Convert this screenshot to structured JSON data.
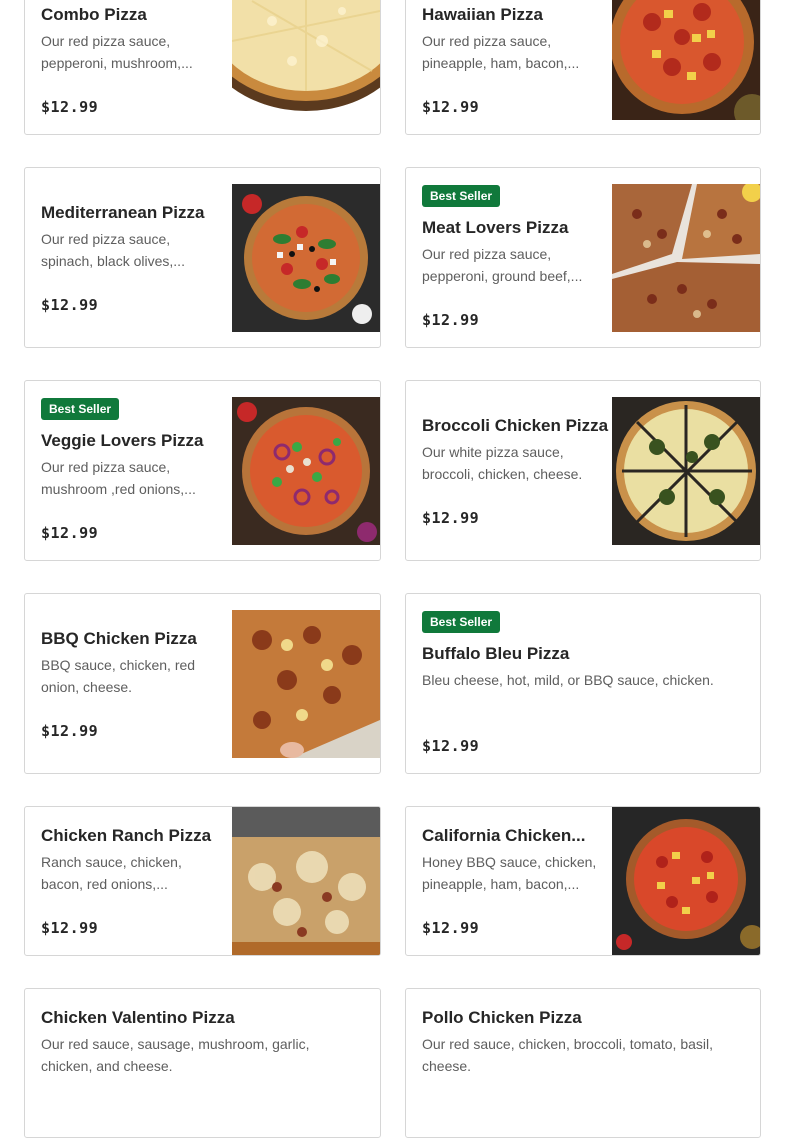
{
  "menu": {
    "items": [
      {
        "name": "Combo Pizza",
        "description_line1": "Our red pizza sauce,",
        "description_line2": "pepperoni, mushroom,...",
        "price": "$12.99",
        "badge": "",
        "image": "combo-pizza-image"
      },
      {
        "name": "Hawaiian Pizza",
        "description_line1": "Our red pizza sauce,",
        "description_line2": "pineapple, ham, bacon,...",
        "price": "$12.99",
        "badge": "",
        "image": "hawaiian-pizza-image"
      },
      {
        "name": "Mediterranean Pizza",
        "description_line1": "Our red pizza sauce,",
        "description_line2": "spinach, black olives,...",
        "price": "$12.99",
        "badge": "",
        "image": "mediterranean-pizza-image"
      },
      {
        "name": "Meat Lovers Pizza",
        "description_line1": "Our red pizza sauce,",
        "description_line2": "pepperoni, ground beef,...",
        "price": "$12.99",
        "badge": "Best Seller",
        "image": "meat-lovers-pizza-image"
      },
      {
        "name": "Veggie Lovers Pizza",
        "description_line1": "Our red pizza sauce,",
        "description_line2": "mushroom ,red onions,...",
        "price": "$12.99",
        "badge": "Best Seller",
        "image": "veggie-lovers-pizza-image"
      },
      {
        "name": "Broccoli Chicken Pizza",
        "description_line1": "Our white pizza sauce,",
        "description_line2": "broccoli, chicken, cheese.",
        "price": "$12.99",
        "badge": "",
        "image": "broccoli-chicken-pizza-image"
      },
      {
        "name": "BBQ Chicken Pizza",
        "description_line1": "BBQ sauce, chicken, red",
        "description_line2": "onion, cheese.",
        "price": "$12.99",
        "badge": "",
        "image": "bbq-chicken-pizza-image"
      },
      {
        "name": "Buffalo Bleu Pizza",
        "description_line1": "Bleu cheese, hot, mild, or BBQ sauce, chicken.",
        "description_line2": "",
        "price": "$12.99",
        "badge": "Best Seller",
        "image": ""
      },
      {
        "name": "Chicken Ranch Pizza",
        "description_line1": "Ranch sauce, chicken,",
        "description_line2": "bacon, red onions,...",
        "price": "$12.99",
        "badge": "",
        "image": "chicken-ranch-pizza-image"
      },
      {
        "name": "California Chicken...",
        "description_line1": "Honey BBQ sauce, chicken,",
        "description_line2": "pineapple, ham, bacon,...",
        "price": "$12.99",
        "badge": "",
        "image": "california-chicken-pizza-image"
      },
      {
        "name": "Chicken Valentino Pizza",
        "description_line1": "Our red sauce, sausage, mushroom, garlic,",
        "description_line2": "chicken, and cheese.",
        "price": "",
        "badge": "",
        "image": ""
      },
      {
        "name": "Pollo Chicken Pizza",
        "description_line1": "Our red sauce, chicken, broccoli, tomato, basil,",
        "description_line2": "cheese.",
        "price": "",
        "badge": "",
        "image": ""
      }
    ]
  },
  "colors": {
    "badge_bg": "#10793b",
    "card_border": "#d6d6d6",
    "title_text": "#262626",
    "description_text": "#5e5e5e"
  }
}
